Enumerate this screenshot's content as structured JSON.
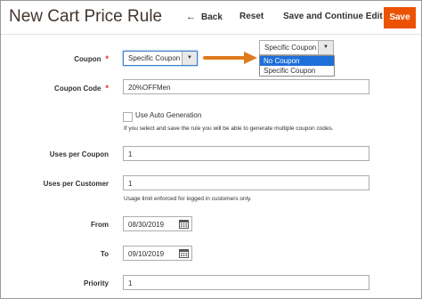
{
  "header": {
    "title": "New Cart Price Rule",
    "back_label": "Back",
    "reset_label": "Reset",
    "save_continue_label": "Save and Continue Edit",
    "save_label": "Save"
  },
  "form": {
    "coupon": {
      "label": "Coupon",
      "required_mark": "*",
      "value": "Specific Coupon"
    },
    "coupon_popup": {
      "value": "Specific Coupon",
      "options": [
        "No Coupon",
        "Specific Coupon"
      ],
      "highlighted_index": 0
    },
    "coupon_code": {
      "label": "Coupon Code",
      "required_mark": "*",
      "value": "20%OFFMen"
    },
    "auto_generation": {
      "label": "Use Auto Generation",
      "checked": false,
      "note": "If you select and save the rule you will be able to generate multiple coupon codes."
    },
    "uses_per_coupon": {
      "label": "Uses per Coupon",
      "value": "1"
    },
    "uses_per_customer": {
      "label": "Uses per Customer",
      "value": "1",
      "note": "Usage limit enforced for logged in customers only."
    },
    "from": {
      "label": "From",
      "value": "08/30/2019"
    },
    "to": {
      "label": "To",
      "value": "09/10/2019"
    },
    "priority": {
      "label": "Priority",
      "value": "1"
    }
  },
  "colors": {
    "accent": "#eb5202",
    "arrow": "#e07a1f",
    "highlight": "#1e6fd9",
    "required": "#e22626"
  },
  "icons": {
    "back": "arrow-left-icon",
    "select": "chevron-down-icon",
    "calendar": "calendar-icon",
    "annotation": "annotation-arrow-icon"
  }
}
